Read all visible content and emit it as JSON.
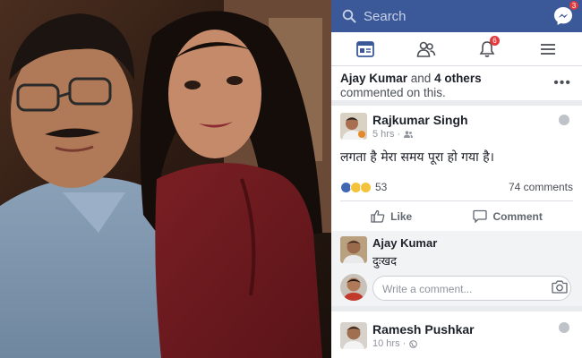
{
  "topbar": {
    "search_placeholder": "Search",
    "messenger_badge": "3",
    "search_icon": "search-icon",
    "messenger_icon": "messenger-icon"
  },
  "navbar": {
    "items": [
      {
        "icon": "news-feed-icon",
        "badge": ""
      },
      {
        "icon": "friends-icon",
        "badge": ""
      },
      {
        "icon": "notifications-bell-icon",
        "badge": "6"
      },
      {
        "icon": "menu-icon",
        "badge": ""
      }
    ]
  },
  "activity": {
    "actor": "Ajay Kumar",
    "connector": " and ",
    "others": "4 others",
    "suffix": "commented on this.",
    "more": "•••"
  },
  "post": {
    "author": "Rajkumar Singh",
    "time": "5 hrs",
    "audience_icon": "friends-audience-icon",
    "text": "लगता है मेरा समय पूरा हो गया है।",
    "reactions": [
      "like",
      "sad",
      "haha"
    ],
    "reaction_count": "53",
    "comment_count": "74 comments",
    "like_label": "Like",
    "comment_label": "Comment"
  },
  "comment": {
    "author": "Ajay Kumar",
    "text": "दुःखद"
  },
  "composer": {
    "placeholder": "Write a comment...",
    "camera_icon": "camera-icon"
  },
  "post2": {
    "author": "Ramesh Pushkar",
    "time": "10 hrs",
    "audience_icon": "public-globe-icon"
  },
  "colors": {
    "brand": "#3b5998",
    "badge": "#e0393e",
    "like": "#4267b2",
    "sad": "#f5c33b",
    "haha": "#f5c33b"
  }
}
